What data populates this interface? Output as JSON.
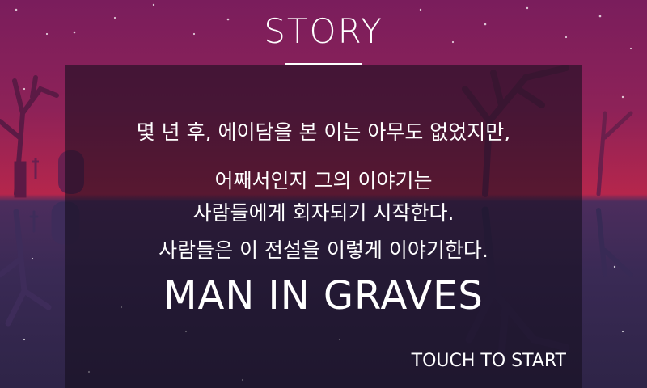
{
  "screen": {
    "title": "STORY",
    "story_lines": [
      "몇 년 후, 에이담을 본 이는 아무도 없었지만,",
      "어째서인지 그의 이야기는",
      "사람들에게 회자되기 시작한다.",
      "사람들은 이 전설을 이렇게 이야기한다."
    ],
    "game_title": "MAN IN GRAVES",
    "touch_prompt": "TOUCH TO START"
  },
  "colors": {
    "sky_top": "#7a1d5c",
    "horizon": "#b5264c",
    "ground": "#2e2447",
    "text": "#ffffff"
  }
}
